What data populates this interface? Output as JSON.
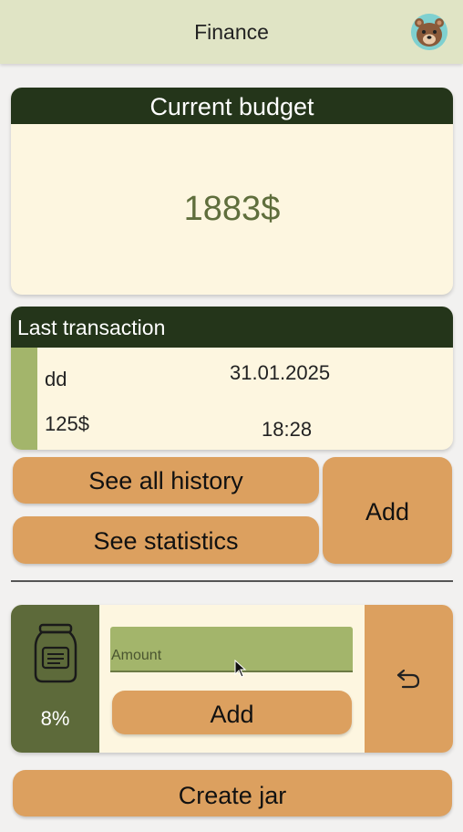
{
  "app": {
    "title": "Finance"
  },
  "budget": {
    "header": "Current budget",
    "amount": "1883$"
  },
  "last_transaction": {
    "header": "Last transaction",
    "name": "dd",
    "amount": "125$",
    "date": "31.01.2025",
    "time": "18:28"
  },
  "actions": {
    "see_history": "See all history",
    "see_statistics": "See statistics",
    "add": "Add"
  },
  "jar": {
    "percent": "8%",
    "amount_placeholder": "Amount",
    "add_label": "Add",
    "undo_icon": "undo-icon"
  },
  "create_jar": "Create jar",
  "colors": {
    "header_dark": "#24351a",
    "card_bg": "#fdf6e0",
    "button": "#dca05f",
    "accent_green": "#a3b56b",
    "jar_dark": "#5d6a3a"
  }
}
